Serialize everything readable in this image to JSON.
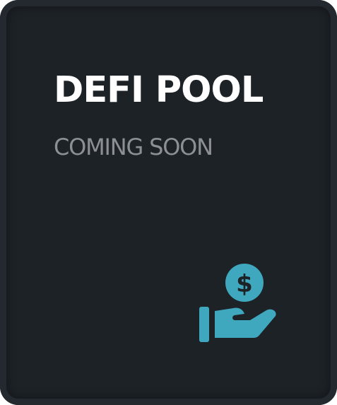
{
  "card": {
    "title": "DEFI POOL",
    "subtitle": "COMING SOON",
    "icon": "hand-holding-dollar-icon",
    "colors": {
      "background": "#1d2227",
      "title": "#ffffff",
      "subtitle": "#8c9094",
      "accent": "#3fa8bf"
    }
  }
}
